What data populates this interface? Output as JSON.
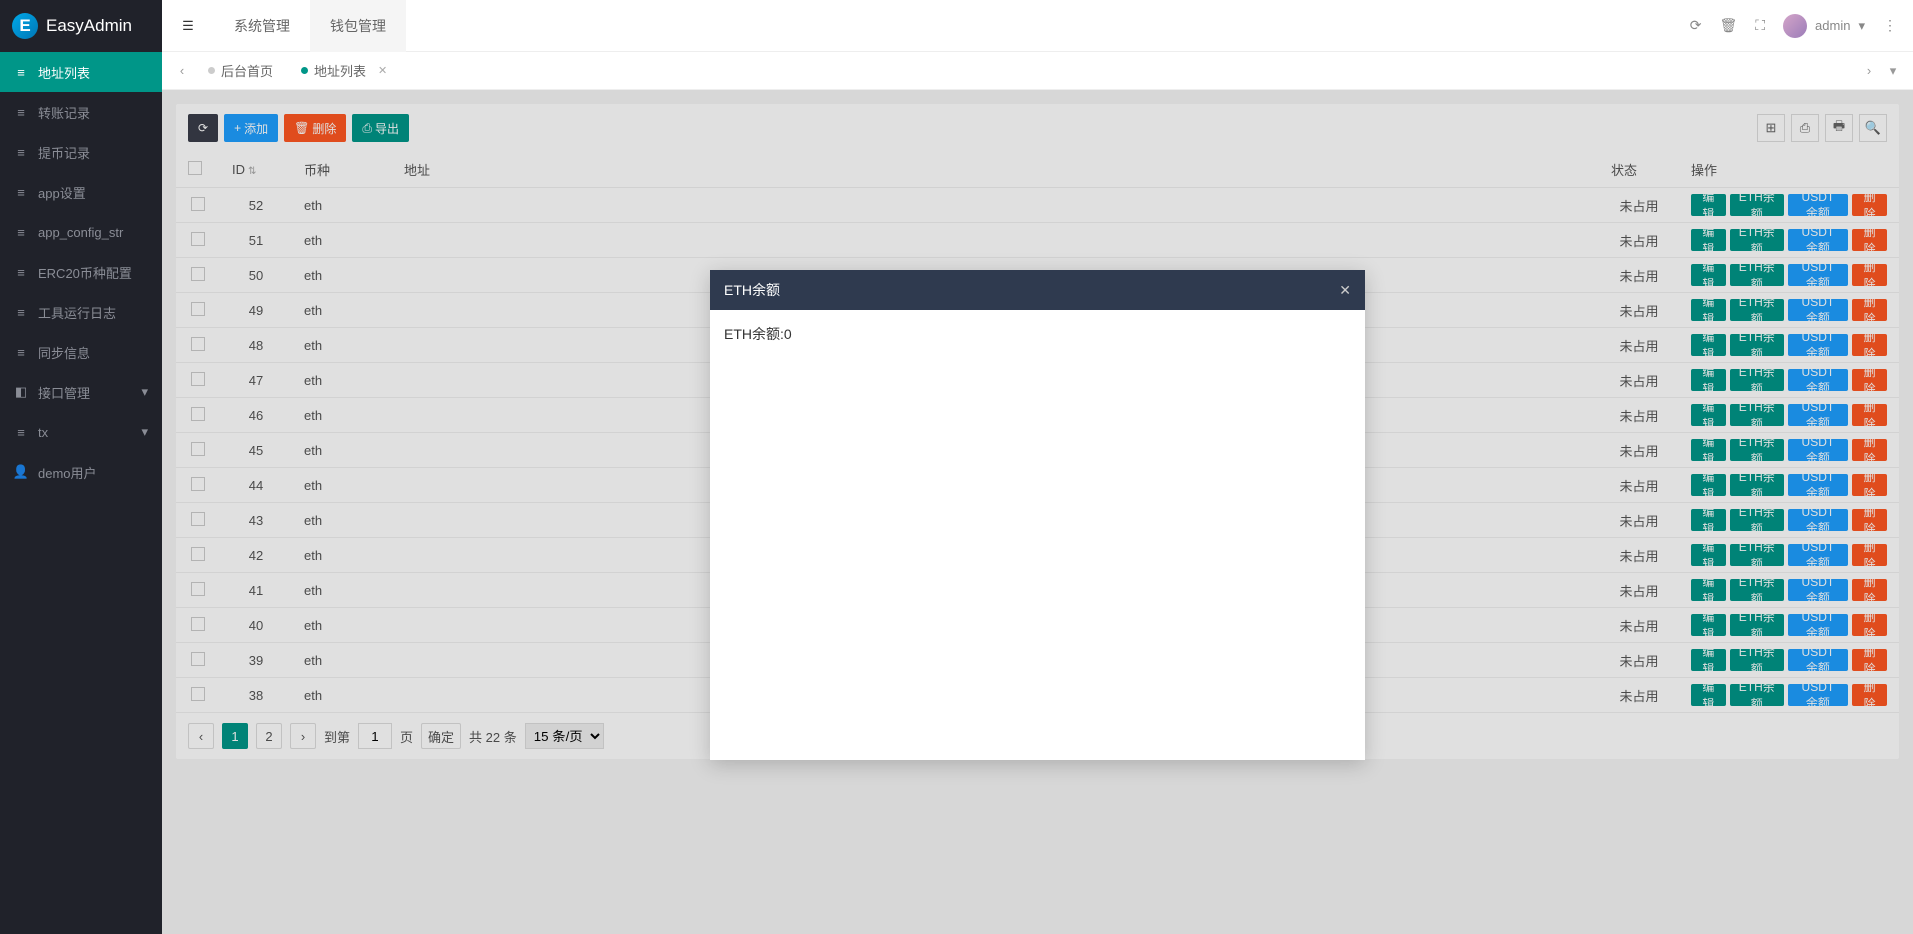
{
  "app": {
    "name": "EasyAdmin"
  },
  "topTabs": {
    "sys": "系统管理",
    "wallet": "钱包管理"
  },
  "header": {
    "user": "admin"
  },
  "breadcrumb": {
    "home": "后台首页",
    "addrList": "地址列表"
  },
  "sidebar": {
    "items": [
      {
        "label": "地址列表",
        "icon": "list"
      },
      {
        "label": "转账记录",
        "icon": "list"
      },
      {
        "label": "提币记录",
        "icon": "list"
      },
      {
        "label": "app设置",
        "icon": "list"
      },
      {
        "label": "app_config_str",
        "icon": "list"
      },
      {
        "label": "ERC20币种配置",
        "icon": "list"
      },
      {
        "label": "工具运行日志",
        "icon": "list"
      },
      {
        "label": "同步信息",
        "icon": "list"
      },
      {
        "label": "接口管理",
        "icon": "port",
        "expandable": true
      },
      {
        "label": "tx",
        "icon": "list",
        "expandable": true
      },
      {
        "label": "demo用户",
        "icon": "user"
      }
    ]
  },
  "toolbar": {
    "add": "添加",
    "delete": "删除",
    "export": "导出"
  },
  "table": {
    "headers": {
      "id": "ID",
      "coin": "币种",
      "address": "地址",
      "status": "状态",
      "ops": "操作"
    },
    "rows": [
      {
        "id": "52",
        "coin": "eth",
        "status": "未占用"
      },
      {
        "id": "51",
        "coin": "eth",
        "status": "未占用"
      },
      {
        "id": "50",
        "coin": "eth",
        "status": "未占用"
      },
      {
        "id": "49",
        "coin": "eth",
        "status": "未占用"
      },
      {
        "id": "48",
        "coin": "eth",
        "status": "未占用"
      },
      {
        "id": "47",
        "coin": "eth",
        "status": "未占用"
      },
      {
        "id": "46",
        "coin": "eth",
        "status": "未占用"
      },
      {
        "id": "45",
        "coin": "eth",
        "status": "未占用"
      },
      {
        "id": "44",
        "coin": "eth",
        "status": "未占用"
      },
      {
        "id": "43",
        "coin": "eth",
        "status": "未占用"
      },
      {
        "id": "42",
        "coin": "eth",
        "status": "未占用"
      },
      {
        "id": "41",
        "coin": "eth",
        "status": "未占用"
      },
      {
        "id": "40",
        "coin": "eth",
        "status": "未占用"
      },
      {
        "id": "39",
        "coin": "eth",
        "status": "未占用"
      },
      {
        "id": "38",
        "coin": "eth",
        "status": "未占用"
      }
    ],
    "opsLabels": {
      "edit": "编辑",
      "eth": "ETH余额",
      "usdt": "USDT余额",
      "delete": "删除"
    }
  },
  "pagination": {
    "page1": "1",
    "page2": "2",
    "goto": "到第",
    "gotoPage": "1",
    "pageUnit": "页",
    "confirm": "确定",
    "total": "共 22 条",
    "perPage": "15 条/页"
  },
  "modal": {
    "title": "ETH余额",
    "body": "ETH余额:0"
  }
}
